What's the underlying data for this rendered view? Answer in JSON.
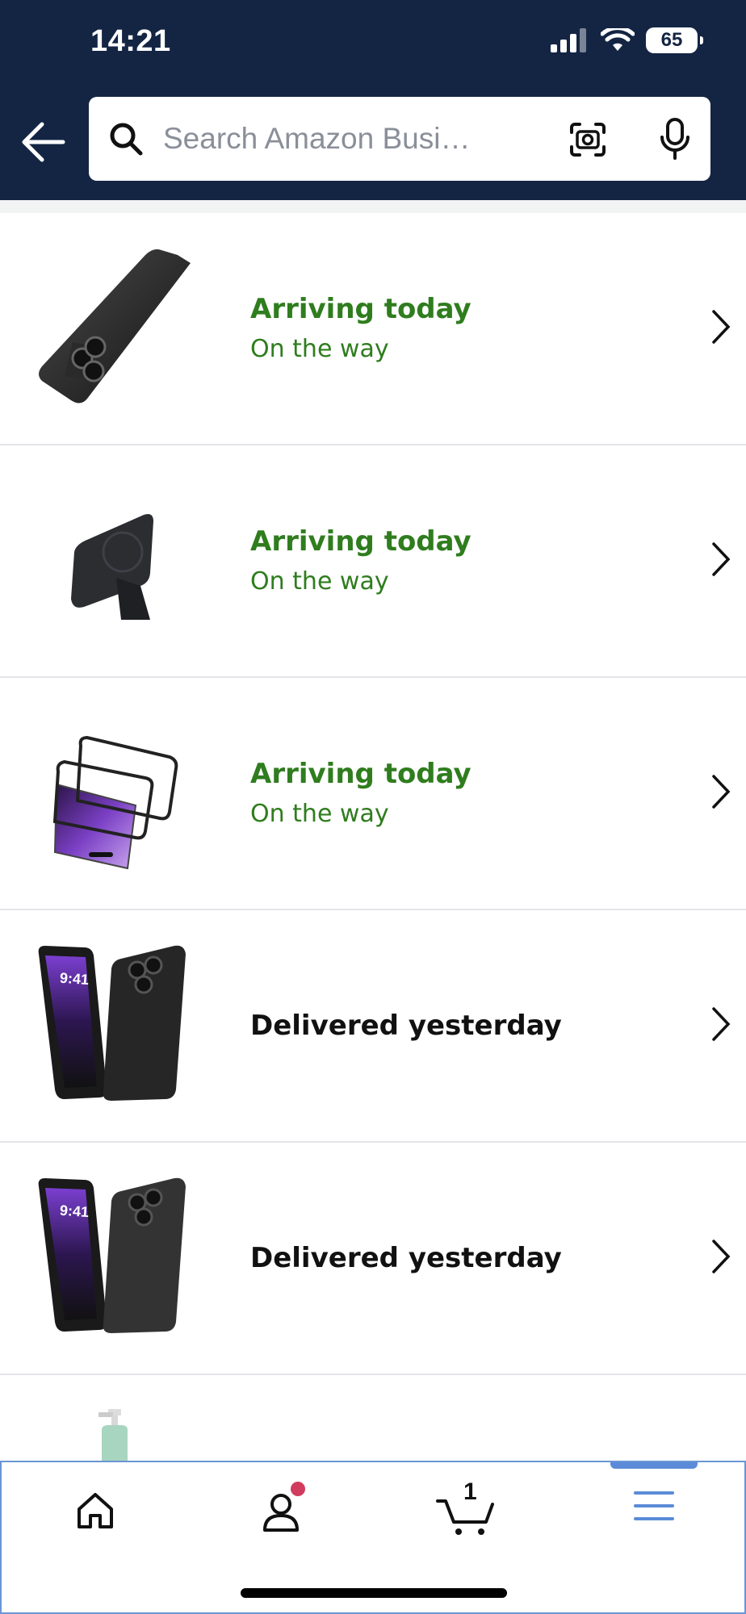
{
  "status_bar": {
    "time": "14:21",
    "battery": "65"
  },
  "search": {
    "placeholder": "Search Amazon Busi…"
  },
  "orders": [
    {
      "status": "Arriving today",
      "substatus": "On the way",
      "product": "black-phone-case"
    },
    {
      "status": "Arriving today",
      "substatus": "On the way",
      "product": "magsafe-battery-stand"
    },
    {
      "status": "Arriving today",
      "substatus": "On the way",
      "product": "screen-protector"
    },
    {
      "status": "Delivered yesterday",
      "substatus": "",
      "product": "iphone-case-pair"
    },
    {
      "status": "Delivered yesterday",
      "substatus": "",
      "product": "iphone-case-pair"
    }
  ],
  "bottom_nav": {
    "items": [
      "home-icon",
      "account-icon",
      "cart-icon",
      "menu-icon"
    ],
    "cart_count": "1",
    "active": "menu"
  },
  "colors": {
    "header_bg": "#142544",
    "status_green": "#2f7d1e",
    "nav_active": "#5b8bd8",
    "notification": "#d13c5e"
  }
}
